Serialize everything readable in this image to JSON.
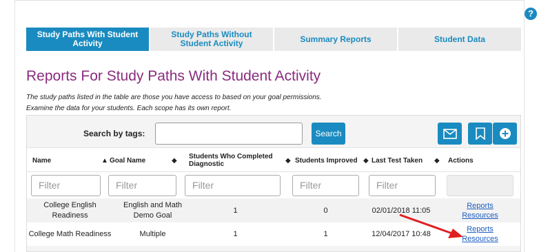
{
  "help": {
    "glyph": "?"
  },
  "tabs": [
    {
      "label": "Study Paths With Student Activity",
      "active": true
    },
    {
      "label": "Study Paths Without Student Activity",
      "active": false
    },
    {
      "label": "Summary Reports",
      "active": false
    },
    {
      "label": "Student Data",
      "active": false
    }
  ],
  "page_title": "Reports For Study Paths With Student Activity",
  "description": [
    "The study paths listed in the table are those you have access to based on your goal permissions.",
    "Examine the data for your students. Each scope has its own report."
  ],
  "search": {
    "label": "Search by tags:",
    "value": "",
    "button": "Search"
  },
  "actions": {
    "email_icon": "envelope-icon",
    "bookmark_icon": "bookmark-icon",
    "add_icon": "plus-circle-icon"
  },
  "table": {
    "headers": [
      {
        "label": "Name",
        "sort": "▲"
      },
      {
        "label": "Goal Name",
        "sort": "◆"
      },
      {
        "label": "Students Who Completed Diagnostic",
        "sort": "◆"
      },
      {
        "label": "Students Improved",
        "sort": "◆"
      },
      {
        "label": "Last Test Taken",
        "sort": "◆"
      },
      {
        "label": "Actions",
        "sort": ""
      }
    ],
    "filter_placeholder": "Filter",
    "rows": [
      {
        "name": "College English Readiness",
        "goal": "English and Math Demo Goal",
        "completed": "1",
        "improved": "0",
        "last_test": "02/01/2018 11:05",
        "link1": "Reports",
        "link2": "Resources"
      },
      {
        "name": "College Math Readiness",
        "goal": "Multiple",
        "completed": "1",
        "improved": "1",
        "last_test": "12/04/2017 10:48",
        "link1": "Reports",
        "link2": "Resources"
      }
    ]
  },
  "colors": {
    "accent": "#1a8bc0",
    "title": "#8a2b7e",
    "annotation_arrow": "#e02020"
  }
}
